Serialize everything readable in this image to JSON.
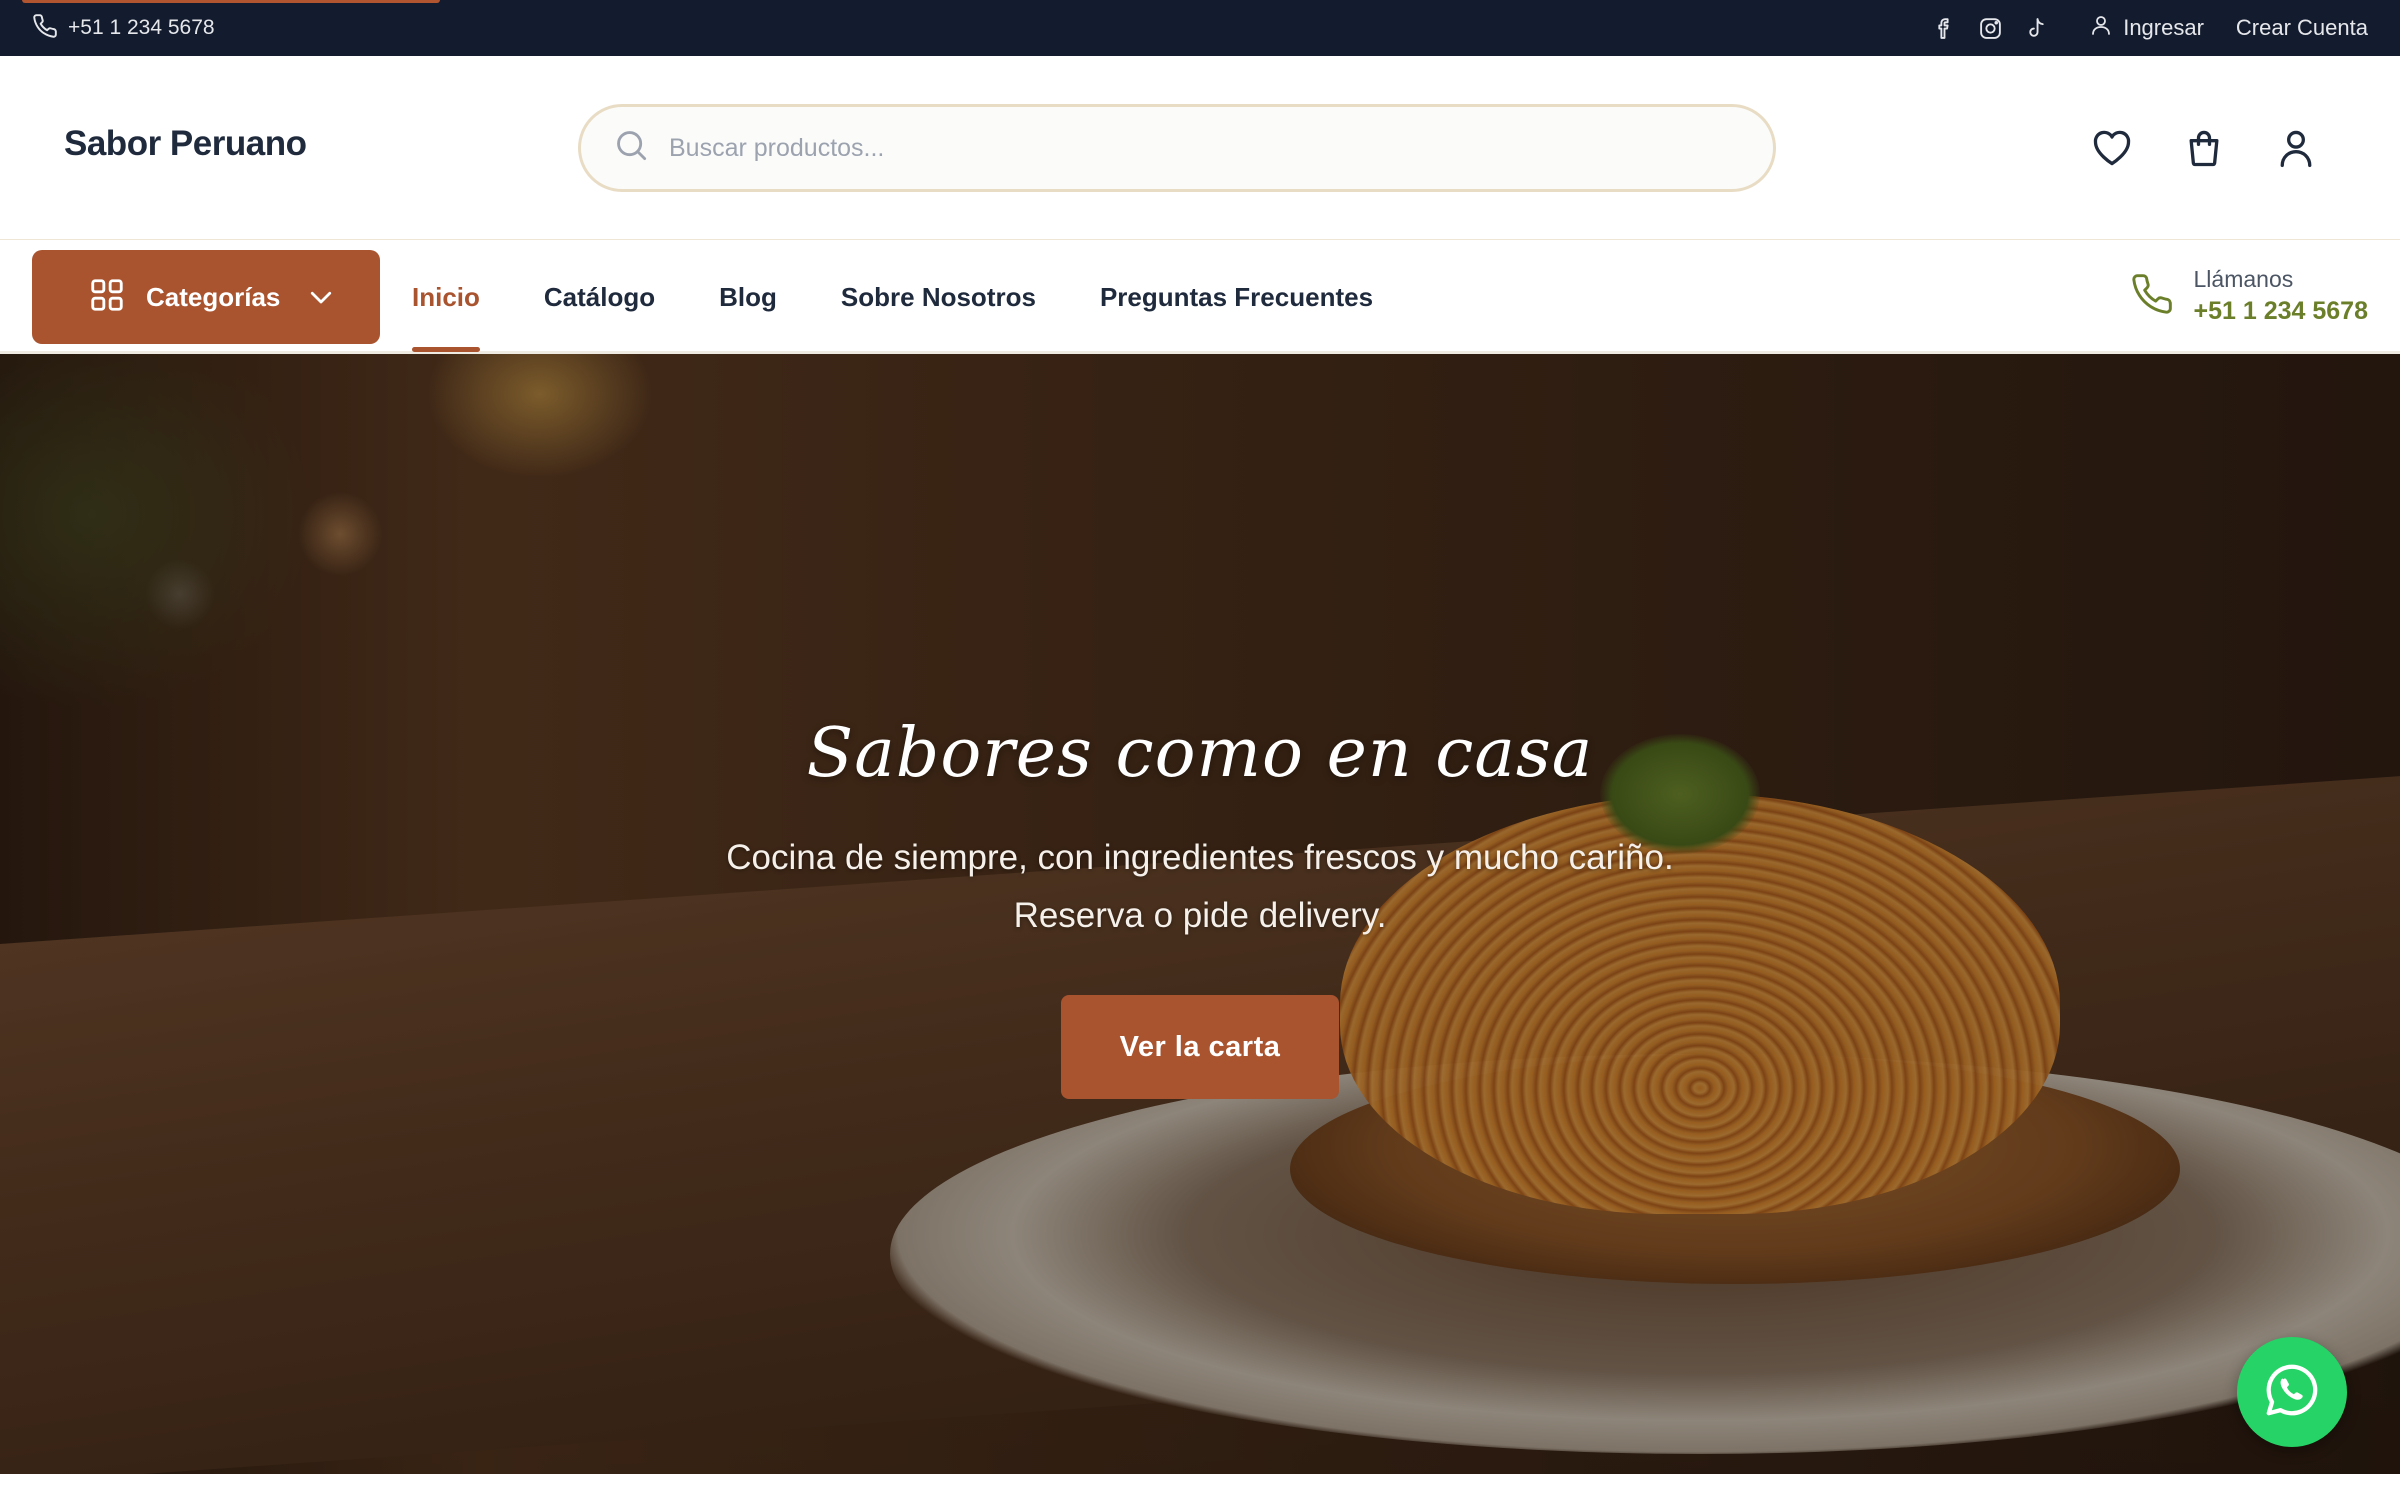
{
  "topbar": {
    "phone": "+51 1 234 5678",
    "social": [
      "facebook-icon",
      "instagram-icon",
      "tiktok-icon"
    ],
    "login_label": "Ingresar",
    "register_label": "Crear Cuenta"
  },
  "header": {
    "logo": "Sabor Peruano",
    "search_placeholder": "Buscar productos...",
    "icons": [
      "heart-icon",
      "shopping-bag-icon",
      "user-icon"
    ]
  },
  "nav": {
    "categories_label": "Categorías",
    "links": [
      {
        "label": "Inicio",
        "active": true
      },
      {
        "label": "Catálogo",
        "active": false
      },
      {
        "label": "Blog",
        "active": false
      },
      {
        "label": "Sobre Nosotros",
        "active": false
      },
      {
        "label": "Preguntas Frecuentes",
        "active": false
      }
    ],
    "contact_label": "Llámanos",
    "contact_phone": "+51 1 234 5678"
  },
  "hero": {
    "title": "Sabores como en casa",
    "subtitle_line1": "Cocina de siempre, con ingredientes frescos y mucho cariño.",
    "subtitle_line2": "Reserva o pide delivery.",
    "cta_label": "Ver la carta"
  },
  "colors": {
    "topbar_bg": "#131b2e",
    "brand": "#a9532f",
    "contact_green": "#6b7f2a",
    "whatsapp": "#25d366"
  }
}
